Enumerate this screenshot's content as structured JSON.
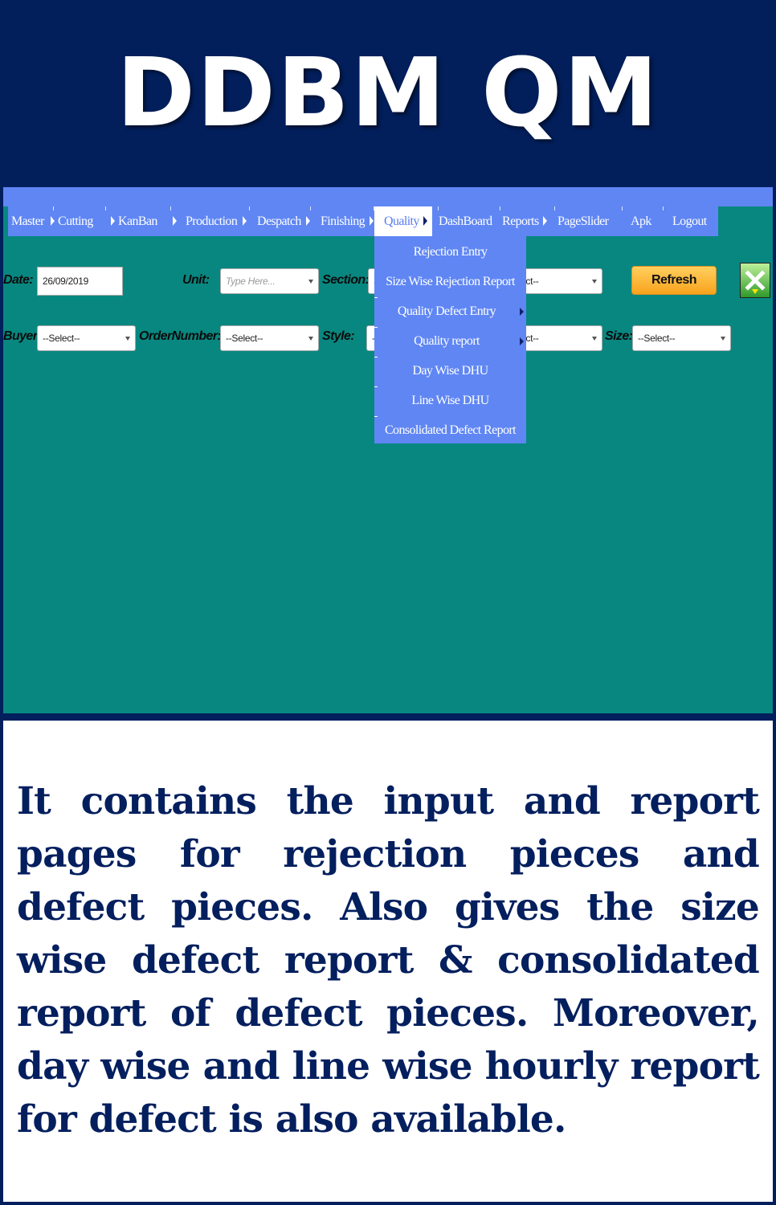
{
  "banner": {
    "title": "DDBM QM"
  },
  "menu": {
    "items": [
      "Master",
      "Cutting",
      "KanBan",
      "Production",
      "Despatch",
      "Finishing",
      "Quality",
      "DashBoard",
      "Reports",
      "PageSlider",
      "Apk",
      "Logout"
    ],
    "active": "Quality"
  },
  "quality_menu": {
    "items": [
      "Rejection Entry",
      "Size Wise Rejection Report",
      "Quality Defect Entry",
      "Quality report",
      "Day Wise DHU",
      "Line Wise DHU",
      "Consolidated Defect Report"
    ]
  },
  "filters": {
    "date_label": "Date:",
    "date_value": "26/09/2019",
    "unit_label": "Unit:",
    "unit_placeholder": "Type Here...",
    "section_label": "Section:",
    "section_value_partial": "S",
    "select_partial_1": "ect--",
    "buyer_label": "Buyer:",
    "buyer_value": "--Select--",
    "order_label": "OrderNumber:",
    "order_value": "--Select--",
    "style_label": "Style:",
    "style_value_partial": "-",
    "select_partial_2": "ect--",
    "size_label": "Size:",
    "size_value": "--Select--",
    "refresh_label": "Refresh"
  },
  "colors": {
    "banner": "#021f5c",
    "menu": "#5f86f3",
    "panel": "#088780",
    "caption_text": "#041f5e"
  },
  "caption": "It contains the input and report pages for rejection pieces and defect pieces. Also gives the size wise defect report & consolidated report of defect pieces. Moreover, day wise and line wise hourly report for defect is also available."
}
